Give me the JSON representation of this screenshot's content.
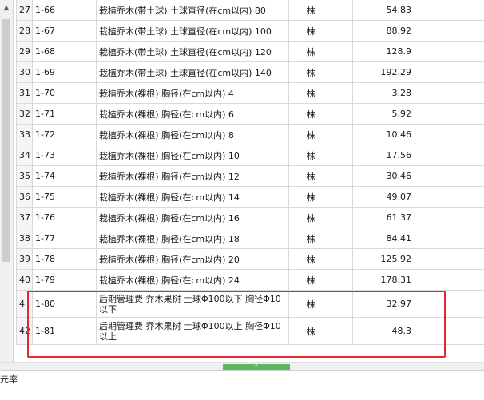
{
  "rows": [
    {
      "idx": "27",
      "code": "1-66",
      "name": "栽植乔木(带土球) 土球直径(在cm以内) 80",
      "unit": "株",
      "qty": "54.83"
    },
    {
      "idx": "28",
      "code": "1-67",
      "name": "栽植乔木(带土球) 土球直径(在cm以内) 100",
      "unit": "株",
      "qty": "88.92"
    },
    {
      "idx": "29",
      "code": "1-68",
      "name": "栽植乔木(带土球) 土球直径(在cm以内) 120",
      "unit": "株",
      "qty": "128.9"
    },
    {
      "idx": "30",
      "code": "1-69",
      "name": "栽植乔木(带土球) 土球直径(在cm以内) 140",
      "unit": "株",
      "qty": "192.29"
    },
    {
      "idx": "31",
      "code": "1-70",
      "name": "栽植乔木(裸根) 胸径(在cm以内) 4",
      "unit": "株",
      "qty": "3.28"
    },
    {
      "idx": "32",
      "code": "1-71",
      "name": "栽植乔木(裸根) 胸径(在cm以内) 6",
      "unit": "株",
      "qty": "5.92"
    },
    {
      "idx": "33",
      "code": "1-72",
      "name": "栽植乔木(裸根) 胸径(在cm以内) 8",
      "unit": "株",
      "qty": "10.46"
    },
    {
      "idx": "34",
      "code": "1-73",
      "name": "栽植乔木(裸根) 胸径(在cm以内) 10",
      "unit": "株",
      "qty": "17.56"
    },
    {
      "idx": "35",
      "code": "1-74",
      "name": "栽植乔木(裸根) 胸径(在cm以内) 12",
      "unit": "株",
      "qty": "30.46"
    },
    {
      "idx": "36",
      "code": "1-75",
      "name": "栽植乔木(裸根) 胸径(在cm以内) 14",
      "unit": "株",
      "qty": "49.07"
    },
    {
      "idx": "37",
      "code": "1-76",
      "name": "栽植乔木(裸根) 胸径(在cm以内) 16",
      "unit": "株",
      "qty": "61.37"
    },
    {
      "idx": "38",
      "code": "1-77",
      "name": "栽植乔木(裸根) 胸径(在cm以内) 18",
      "unit": "株",
      "qty": "84.41"
    },
    {
      "idx": "39",
      "code": "1-78",
      "name": "栽植乔木(裸根) 胸径(在cm以内) 20",
      "unit": "株",
      "qty": "125.92"
    },
    {
      "idx": "40",
      "code": "1-79",
      "name": "栽植乔木(裸根) 胸径(在cm以内) 24",
      "unit": "株",
      "qty": "178.31"
    },
    {
      "idx": "4",
      "code": "1-80",
      "name": "后期管理费 乔木果树 土球Φ100以下 胸径Φ10以下",
      "unit": "株",
      "qty": "32.97"
    },
    {
      "idx": "42",
      "code": "1-81",
      "name": "后期管理费 乔木果树 土球Φ100以上 胸径Φ10以上",
      "unit": "株",
      "qty": "48.3"
    }
  ],
  "icons": {
    "scroll_up": "▲",
    "grip": "⌃"
  },
  "footer": {
    "tab_fragment": "元率"
  },
  "colors": {
    "highlight": "#e8262d",
    "hscroll_handle": "#5cb85c"
  }
}
